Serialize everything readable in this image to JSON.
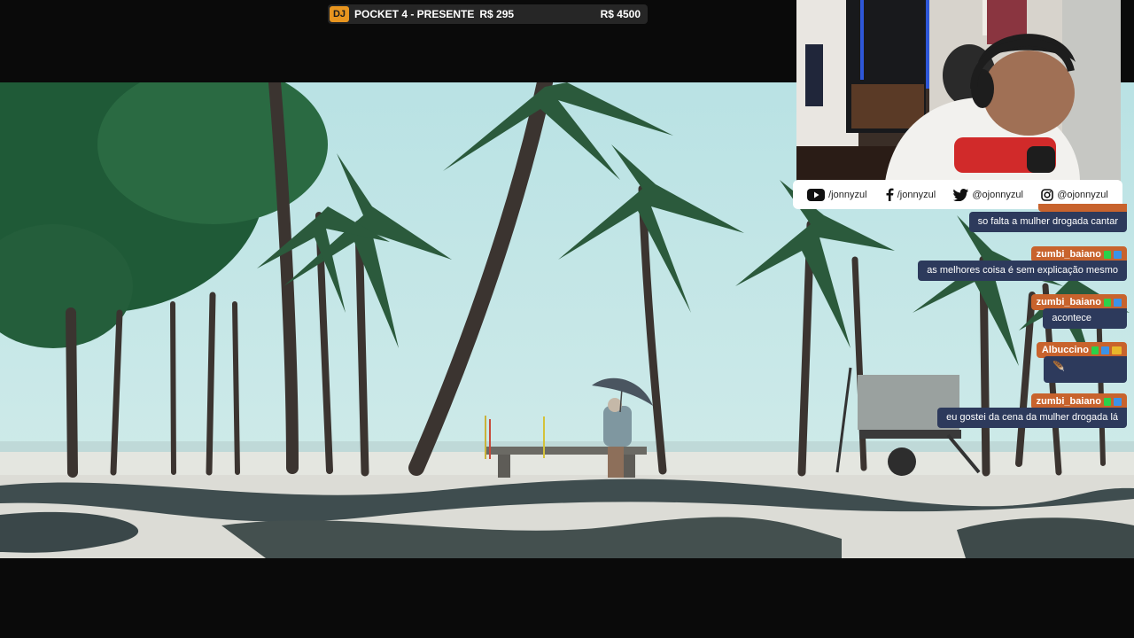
{
  "goal": {
    "badge": "DJ",
    "title": "POCKET 4 - PRESENTE",
    "current": "R$ 295",
    "target": "R$ 4500",
    "progress_fraction": 0.066
  },
  "socials": [
    {
      "icon": "youtube-icon",
      "handle": "/jonnyzul"
    },
    {
      "icon": "facebook-icon",
      "handle": "/jonnyzul"
    },
    {
      "icon": "twitter-icon",
      "handle": "@ojonnyzul"
    },
    {
      "icon": "instagram-icon",
      "handle": "@ojonnyzul"
    }
  ],
  "chat": {
    "messages": [
      {
        "user": "",
        "text": "so falta a mulher drogada cantar"
      },
      {
        "user": "zumbi_baiano",
        "text": "as melhores coisa é sem explicação mesmo"
      },
      {
        "user": "zumbi_baiano",
        "text": "acontece"
      },
      {
        "user": "Albuccino",
        "text": "🪶"
      },
      {
        "user": "zumbi_baiano",
        "text": "eu gostei da cena da mulher drogada lá"
      }
    ]
  },
  "colors": {
    "goal_badge": "#e8951f",
    "chat_username_bg": "#c8632d",
    "chat_message_bg": "#2d3a5c",
    "page_bg": "#0a0a0a"
  }
}
